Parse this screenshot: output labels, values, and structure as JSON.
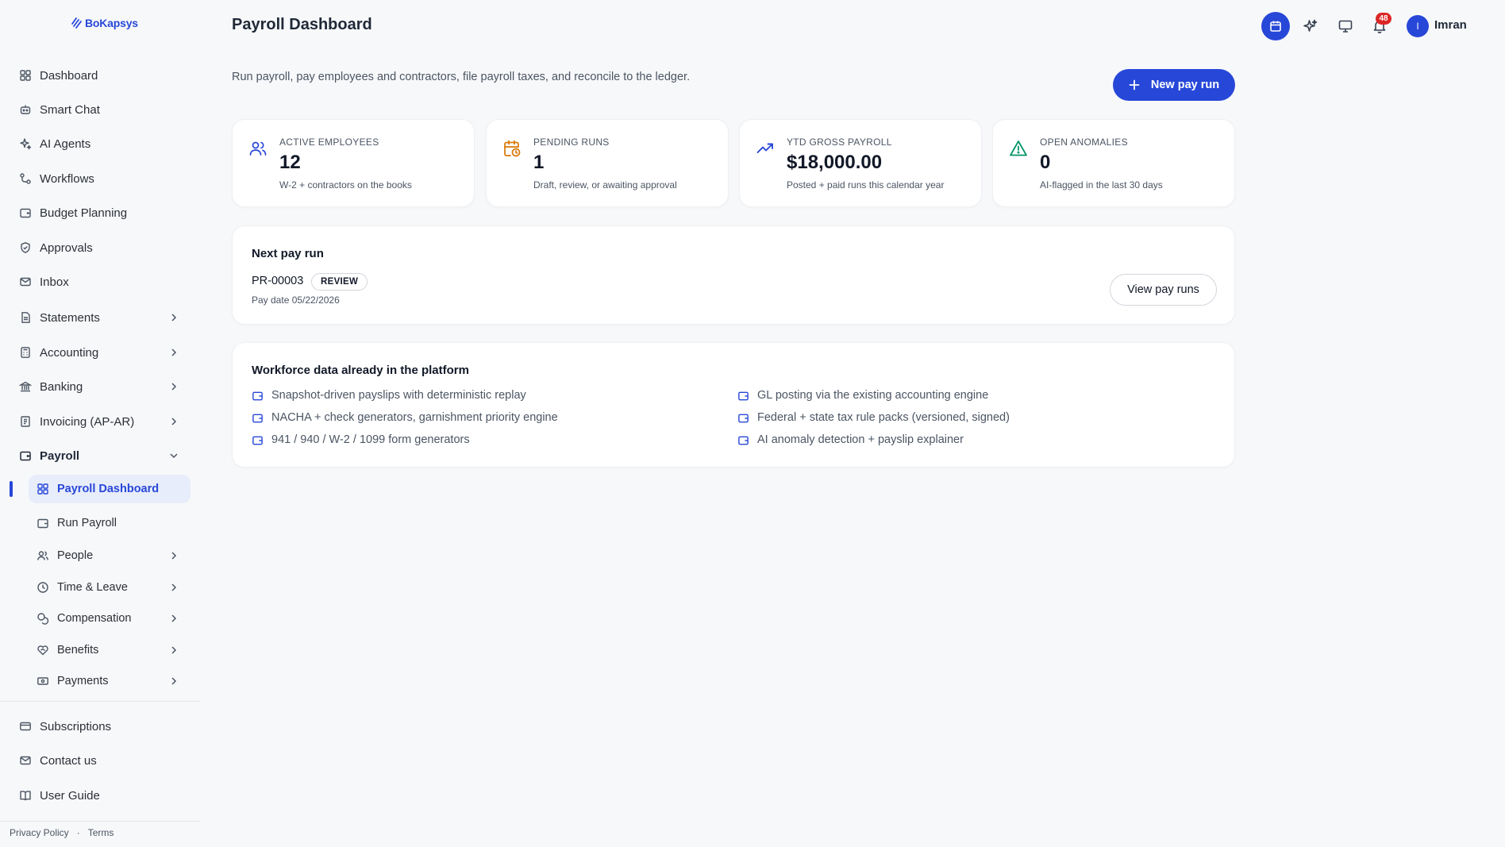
{
  "brand": {
    "name": "BoKapsys",
    "color": "#2747d8"
  },
  "sidebar": {
    "items": [
      {
        "label": "Dashboard",
        "icon": "grid-icon"
      },
      {
        "label": "Smart Chat",
        "icon": "bot-icon"
      },
      {
        "label": "AI Agents",
        "icon": "sparkles-icon"
      },
      {
        "label": "Workflows",
        "icon": "workflow-icon"
      },
      {
        "label": "Budget Planning",
        "icon": "wallet-icon"
      },
      {
        "label": "Approvals",
        "icon": "shield-check-icon"
      },
      {
        "label": "Inbox",
        "icon": "mail-icon"
      },
      {
        "label": "Statements",
        "icon": "file-text-icon"
      },
      {
        "label": "Accounting",
        "icon": "calculator-icon"
      },
      {
        "label": "Banking",
        "icon": "bank-icon"
      },
      {
        "label": "Invoicing (AP-AR)",
        "icon": "receipt-icon"
      },
      {
        "label": "Payroll",
        "icon": "wallet-icon"
      }
    ],
    "payroll_sub": [
      {
        "label": "Payroll Dashboard",
        "icon": "grid-icon"
      },
      {
        "label": "Run Payroll",
        "icon": "wallet-icon"
      },
      {
        "label": "People",
        "icon": "users-icon"
      },
      {
        "label": "Time & Leave",
        "icon": "clock-icon"
      },
      {
        "label": "Compensation",
        "icon": "coins-icon"
      },
      {
        "label": "Benefits",
        "icon": "heart-handshake-icon"
      },
      {
        "label": "Payments",
        "icon": "banknote-icon"
      }
    ],
    "bottom": [
      {
        "label": "Subscriptions",
        "icon": "credit-card-icon"
      },
      {
        "label": "Contact us",
        "icon": "mail-icon"
      },
      {
        "label": "User Guide",
        "icon": "book-icon"
      }
    ],
    "footer": {
      "privacy": "Privacy Policy",
      "separator": "·",
      "terms": "Terms"
    }
  },
  "header": {
    "title": "Payroll Dashboard",
    "notifications_count": "48",
    "user": {
      "initial": "I",
      "name": "Imran"
    }
  },
  "main": {
    "subtitle": "Run payroll, pay employees and contractors, file payroll taxes, and reconcile to the ledger.",
    "new_run_label": "New pay run",
    "stats": [
      {
        "label": "ACTIVE EMPLOYEES",
        "value": "12",
        "note": "W-2 + contractors on the books",
        "icon": "users-icon",
        "color": "#2747d8"
      },
      {
        "label": "PENDING RUNS",
        "value": "1",
        "note": "Draft, review, or awaiting approval",
        "icon": "calendar-clock-icon",
        "color": "#d97706"
      },
      {
        "label": "YTD GROSS PAYROLL",
        "value": "$18,000.00",
        "note": "Posted + paid runs this calendar year",
        "icon": "trending-up-icon",
        "color": "#2747d8"
      },
      {
        "label": "OPEN ANOMALIES",
        "value": "0",
        "note": "AI-flagged in the last 30 days",
        "icon": "alert-triangle-icon",
        "color": "#059669"
      }
    ],
    "next_run": {
      "title": "Next pay run",
      "id": "PR-00003",
      "status": "REVIEW",
      "date": "Pay date 05/22/2026",
      "view_label": "View pay runs"
    },
    "workforce": {
      "title": "Workforce data already in the platform",
      "left": [
        "Snapshot-driven payslips with deterministic replay",
        "NACHA + check generators, garnishment priority engine",
        "941 / 940 / W-2 / 1099 form generators"
      ],
      "right": [
        "GL posting via the existing accounting engine",
        "Federal + state tax rule packs (versioned, signed)",
        "AI anomaly detection + payslip explainer"
      ]
    }
  }
}
